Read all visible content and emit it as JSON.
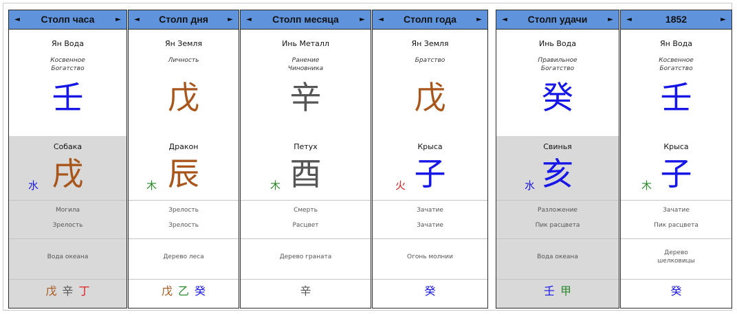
{
  "colors": {
    "water": "#1616e6",
    "earth": "#a8561c",
    "metal": "#555555",
    "fire": "#e02020",
    "wood": "#2a8a2a"
  },
  "columns": [
    {
      "title": "Столп часа",
      "stem_name": "Ян Вода",
      "stem_god": "Косвенное Богатство",
      "stem_char": "壬",
      "stem_color": "water",
      "branch_name": "Собака",
      "branch_char": "戌",
      "branch_color": "earth",
      "element_char": "水",
      "element_color": "water",
      "stage1": "Могила",
      "stage2": "Зрелость",
      "melody": "Вода океана",
      "hidden": [
        {
          "char": "戊",
          "color": "earth"
        },
        {
          "char": "辛",
          "color": "metal"
        },
        {
          "char": "丁",
          "color": "fire"
        }
      ]
    },
    {
      "title": "Столп дня",
      "stem_name": "Ян Земля",
      "stem_god": "Личность",
      "stem_char": "戊",
      "stem_color": "earth",
      "branch_name": "Дракон",
      "branch_char": "辰",
      "branch_color": "earth",
      "element_char": "木",
      "element_color": "wood",
      "stage1": "Зрелость",
      "stage2": "Зрелость",
      "melody": "Дерево леса",
      "hidden": [
        {
          "char": "戊",
          "color": "earth"
        },
        {
          "char": "乙",
          "color": "wood"
        },
        {
          "char": "癸",
          "color": "water"
        }
      ]
    },
    {
      "title": "Столп месяца",
      "stem_name": "Инь Металл",
      "stem_god": "Ранение Чиновника",
      "stem_char": "辛",
      "stem_color": "metal",
      "branch_name": "Петух",
      "branch_char": "酉",
      "branch_color": "metal",
      "element_char": "木",
      "element_color": "wood",
      "stage1": "Смерть",
      "stage2": "Расцвет",
      "melody": "Дерево граната",
      "hidden": [
        {
          "char": "辛",
          "color": "metal"
        }
      ]
    },
    {
      "title": "Столп года",
      "stem_name": "Ян Земля",
      "stem_god": "Братство",
      "stem_char": "戊",
      "stem_color": "earth",
      "branch_name": "Крыса",
      "branch_char": "子",
      "branch_color": "water",
      "element_char": "火",
      "element_color": "fire",
      "stage1": "Зачатие",
      "stage2": "Зачатие",
      "melody": "Огонь молнии",
      "hidden": [
        {
          "char": "癸",
          "color": "water"
        }
      ]
    },
    {
      "title": "Столп удачи",
      "stem_name": "Инь Вода",
      "stem_god": "Правильное Богатство",
      "stem_char": "癸",
      "stem_color": "water",
      "branch_name": "Свинья",
      "branch_char": "亥",
      "branch_color": "water",
      "element_char": "水",
      "element_color": "water",
      "stage1": "Разложение",
      "stage2": "Пик расцвета",
      "melody": "Вода океана",
      "hidden": [
        {
          "char": "壬",
          "color": "water"
        },
        {
          "char": "甲",
          "color": "wood"
        }
      ]
    },
    {
      "title": "1852",
      "stem_name": "Ян Вода",
      "stem_god": "Косвенное Богатство",
      "stem_char": "壬",
      "stem_color": "water",
      "branch_name": "Крыса",
      "branch_char": "子",
      "branch_color": "water",
      "element_char": "木",
      "element_color": "wood",
      "stage1": "Зачатие",
      "stage2": "Пик расцвета",
      "melody": "Дерево шелковицы",
      "hidden": [
        {
          "char": "癸",
          "color": "water"
        }
      ]
    }
  ],
  "header": {
    "prev_icon": "triangle-left-icon",
    "next_icon": "triangle-right-icon",
    "prev_glyph": "◄",
    "next_glyph": "►"
  }
}
